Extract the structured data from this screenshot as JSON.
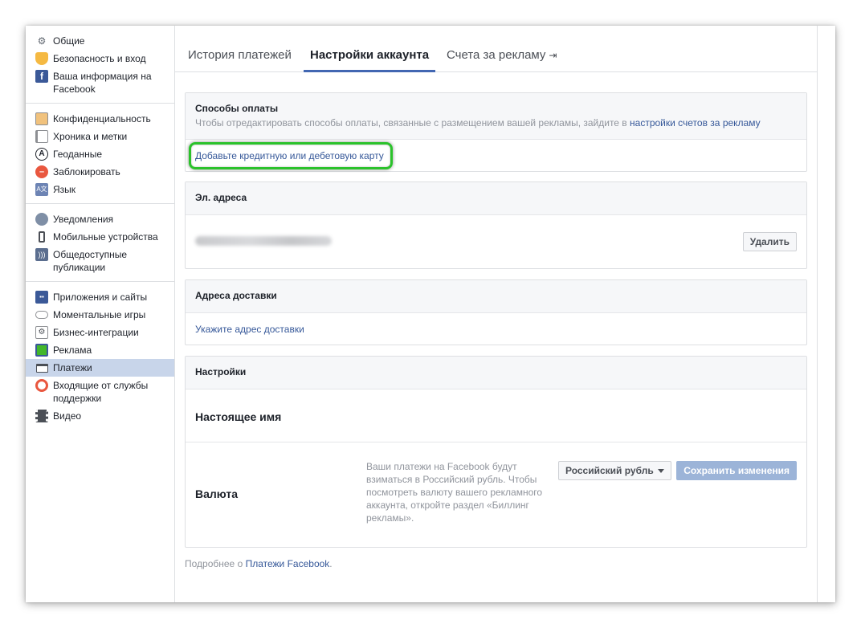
{
  "sidebar": {
    "groups": [
      {
        "items": [
          {
            "label": "Общие",
            "icon": "gears-icon"
          },
          {
            "label": "Безопасность и вход",
            "icon": "shield-icon"
          },
          {
            "label": "Ваша информация на Facebook",
            "icon": "facebook-icon"
          }
        ]
      },
      {
        "items": [
          {
            "label": "Конфиденциальность",
            "icon": "lock-icon"
          },
          {
            "label": "Хроника и метки",
            "icon": "timeline-icon"
          },
          {
            "label": "Геоданные",
            "icon": "location-icon"
          },
          {
            "label": "Заблокировать",
            "icon": "block-icon"
          },
          {
            "label": "Язык",
            "icon": "language-icon"
          }
        ]
      },
      {
        "items": [
          {
            "label": "Уведомления",
            "icon": "globe-icon"
          },
          {
            "label": "Мобильные устройства",
            "icon": "mobile-icon"
          },
          {
            "label": "Общедоступные публикации",
            "icon": "rss-icon"
          }
        ]
      },
      {
        "items": [
          {
            "label": "Приложения и сайты",
            "icon": "apps-icon"
          },
          {
            "label": "Моментальные игры",
            "icon": "gamepad-icon"
          },
          {
            "label": "Бизнес-интеграции",
            "icon": "business-icon"
          },
          {
            "label": "Реклама",
            "icon": "ads-icon"
          },
          {
            "label": "Платежи",
            "icon": "card-icon",
            "active": true
          },
          {
            "label": "Входящие от службы поддержки",
            "icon": "lifebuoy-icon"
          },
          {
            "label": "Видео",
            "icon": "film-icon"
          }
        ]
      }
    ]
  },
  "tabs": {
    "history": "История платежей",
    "settings": "Настройки аккаунта",
    "ad_accounts": "Счета за рекламу",
    "ad_accounts_icon": "⇥"
  },
  "payment_methods": {
    "title": "Способы оплаты",
    "desc_prefix": "Чтобы отредактировать способы оплаты, связанные с размещением вашей рекламы, зайдите в",
    "desc_link": "настройки счетов за рекламу",
    "add_card": "Добавьте кредитную или дебетовую карту"
  },
  "emails": {
    "title": "Эл. адреса",
    "delete": "Удалить"
  },
  "shipping": {
    "title": "Адреса доставки",
    "add": "Укажите адрес доставки"
  },
  "settings": {
    "title": "Настройки",
    "real_name": "Настоящее имя",
    "currency_label": "Валюта",
    "currency_note": "Ваши платежи на Facebook будут взиматься в Российский рубль. Чтобы посмотреть валюту вашего рекламного аккаунта, откройте раздел «Биллинг рекламы».",
    "currency_select": "Российский рубль",
    "save": "Сохранить изменения"
  },
  "footer": {
    "prefix": "Подробнее о",
    "link": "Платежи Facebook",
    "suffix": "."
  },
  "colors": {
    "accent": "#4267b2",
    "link": "#365899",
    "highlight": "#2bc22b",
    "active_bg": "#c8d5ea"
  }
}
